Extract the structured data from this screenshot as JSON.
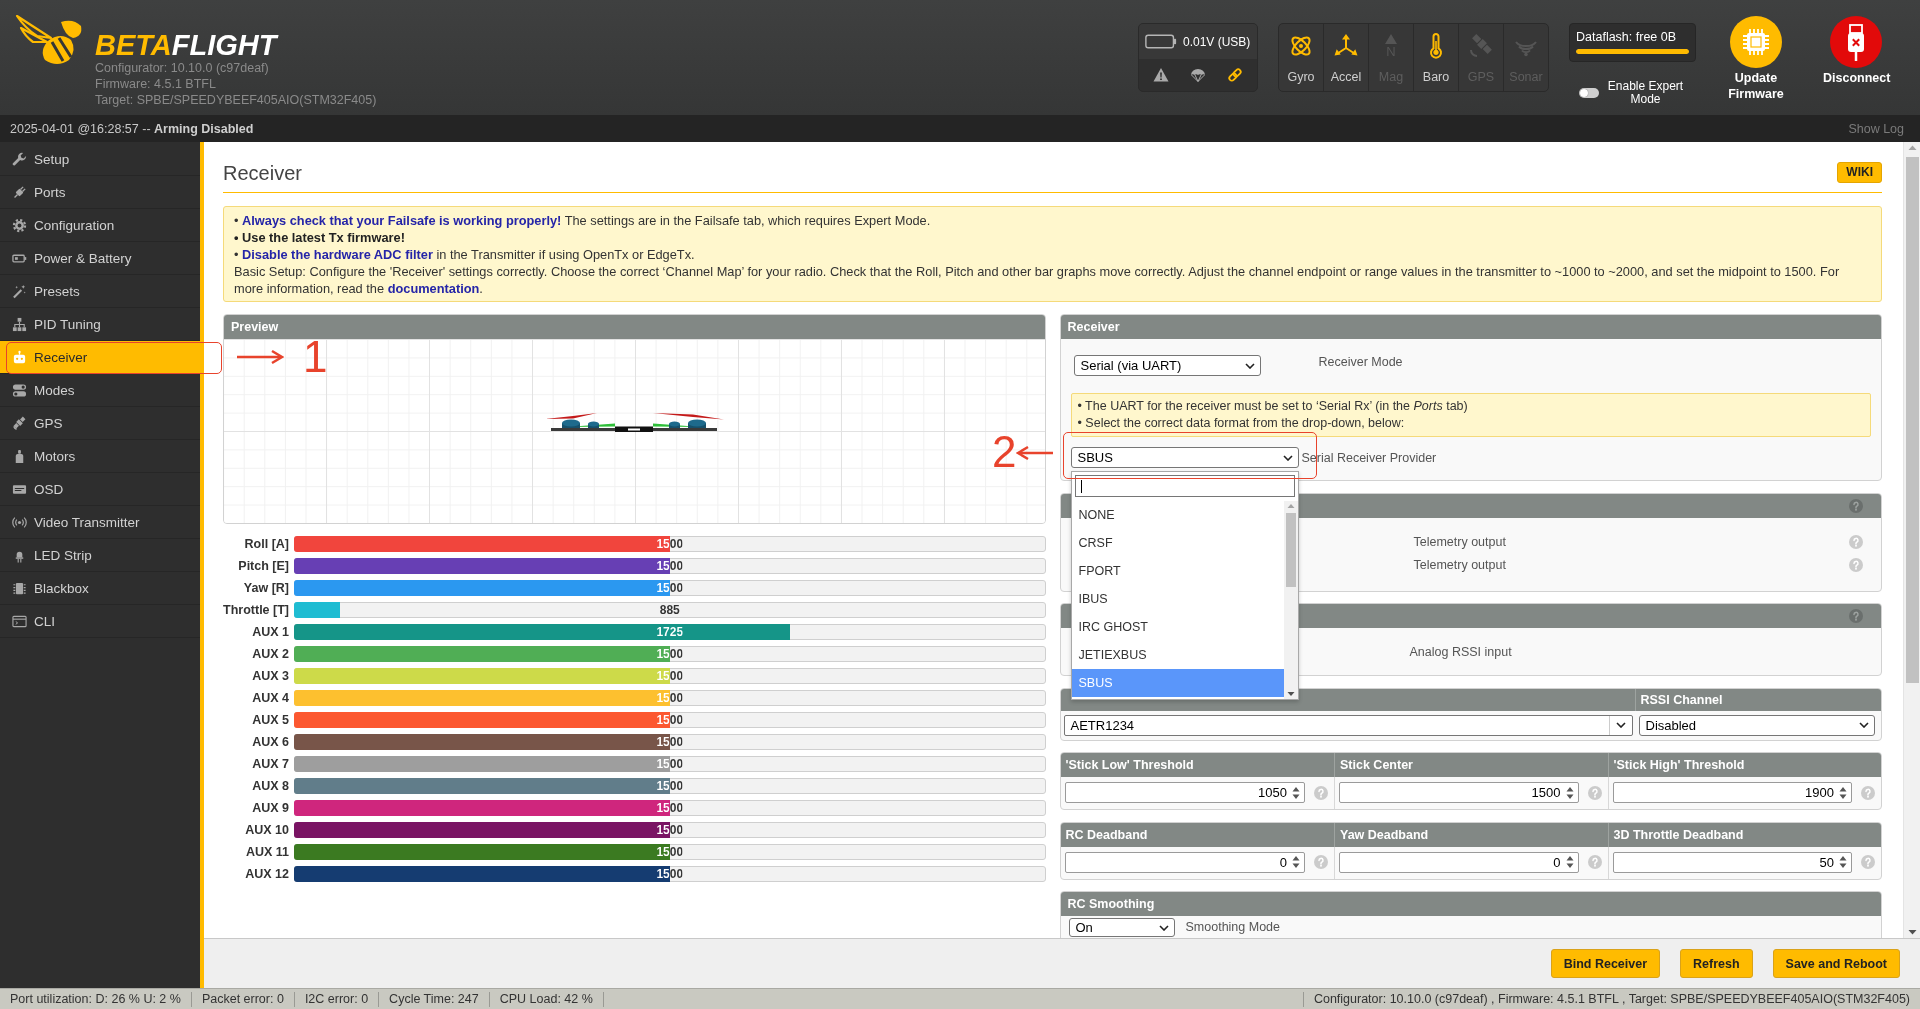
{
  "header": {
    "logo": {
      "first": "BETA",
      "second": "FLIGHT"
    },
    "version_lines": [
      "Configurator: 10.10.0 (c97deaf)",
      "Firmware: 4.5.1 BTFL",
      "Target: SPBE/SPEEDYBEEF405AIO(STM32F405)"
    ],
    "battery": {
      "reading": "0.01V (USB)",
      "indicators": [
        {
          "on": false
        },
        {
          "on": false
        },
        {
          "on": true
        }
      ]
    },
    "sensors": [
      {
        "label": "Gyro",
        "on": true
      },
      {
        "label": "Accel",
        "on": true
      },
      {
        "label": "Mag",
        "on": false,
        "symbol": "N"
      },
      {
        "label": "Baro",
        "on": true
      },
      {
        "label": "GPS",
        "on": false
      },
      {
        "label": "Sonar",
        "on": false
      }
    ],
    "dataflash": {
      "label": "Dataflash: free 0B",
      "level": 1
    },
    "expert_mode": {
      "label": "Enable Expert Mode",
      "on": false
    },
    "buttons": [
      {
        "kind": "update",
        "label": "Update Firmware"
      },
      {
        "kind": "disconnect",
        "label": "Disconnect"
      }
    ]
  },
  "status_strip": {
    "message": "2025-04-01 @16:28:57 -- **Arming Disabled**",
    "show_log": "Show Log"
  },
  "sidebar": {
    "items": [
      {
        "label": "Setup",
        "selected": false
      },
      {
        "label": "Ports",
        "selected": false
      },
      {
        "label": "Configuration",
        "selected": false
      },
      {
        "label": "Power & Battery",
        "selected": false
      },
      {
        "label": "Presets",
        "selected": false
      },
      {
        "label": "PID Tuning",
        "selected": false
      },
      {
        "label": "Receiver",
        "selected": true
      },
      {
        "label": "Modes",
        "selected": false
      },
      {
        "label": "GPS",
        "selected": false
      },
      {
        "label": "Motors",
        "selected": false
      },
      {
        "label": "OSD",
        "selected": false
      },
      {
        "label": "Video Transmitter",
        "selected": false
      },
      {
        "label": "LED Strip",
        "selected": false
      },
      {
        "label": "Blackbox",
        "selected": false
      },
      {
        "label": "CLI",
        "selected": false
      }
    ]
  },
  "page": {
    "title": "Receiver",
    "wiki_button": "WIKI",
    "notes": [
      {
        "kind": "text",
        "text": "• **Always check that your Failsafe is working properly!** The settings are in the Failsafe tab, which requires Expert Mode."
      },
      {
        "kind": "strong",
        "text": "• Use the latest Tx firmware!"
      },
      {
        "kind": "text",
        "text": "• **Disable the hardware ADC filter** in the Transmitter if using OpenTx or EdgeTx."
      },
      {
        "kind": "text",
        "text": "Basic Setup: Configure the 'Receiver' settings correctly. Choose the correct ‘Channel Map’ for your radio. Check that the Roll, Pitch and other bar graphs move correctly. Adjust the channel endpoint or range values in the transmitter to ~1000 to ~2000, and set the midpoint to 1500. For more information, read the **documentation**."
      }
    ]
  },
  "preview": {
    "title": "Preview"
  },
  "channels": [
    {
      "name": "Roll [A]",
      "reading": "1500",
      "level": 0.5,
      "color": "#f1453d"
    },
    {
      "name": "Pitch [E]",
      "reading": "1500",
      "level": 0.5,
      "color": "#673fb4"
    },
    {
      "name": "Yaw [R]",
      "reading": "1500",
      "level": 0.5,
      "color": "#2b98f0"
    },
    {
      "name": "Throttle [T]",
      "reading": "885",
      "level": 0.0607,
      "color": "#1fbcd2"
    },
    {
      "name": "AUX 1",
      "reading": "1725",
      "level": 0.6607,
      "color": "#159588"
    },
    {
      "name": "AUX 2",
      "reading": "1500",
      "level": 0.5,
      "color": "#50ae55"
    },
    {
      "name": "AUX 3",
      "reading": "1500",
      "level": 0.5,
      "color": "#cdda49"
    },
    {
      "name": "AUX 4",
      "reading": "1500",
      "level": 0.5,
      "color": "#fdc02f"
    },
    {
      "name": "AUX 5",
      "reading": "1500",
      "level": 0.5,
      "color": "#fc5830"
    },
    {
      "name": "AUX 6",
      "reading": "1500",
      "level": 0.5,
      "color": "#785549"
    },
    {
      "name": "AUX 7",
      "reading": "1500",
      "level": 0.5,
      "color": "#9e9e9e"
    },
    {
      "name": "AUX 8",
      "reading": "1500",
      "level": 0.5,
      "color": "#617d8a"
    },
    {
      "name": "AUX 9",
      "reading": "1500",
      "level": 0.5,
      "color": "#cf267d"
    },
    {
      "name": "AUX 10",
      "reading": "1500",
      "level": 0.5,
      "color": "#7a1464"
    },
    {
      "name": "AUX 11",
      "reading": "1500",
      "level": 0.5,
      "color": "#3b7a21"
    },
    {
      "name": "AUX 12",
      "reading": "1500",
      "level": 0.5,
      "color": "#153c71"
    }
  ],
  "receiver_panel": {
    "title": "Receiver",
    "mode": {
      "value": "Serial (via UART)",
      "label": "Receiver Mode"
    },
    "notes": [
      "• The UART for the receiver must be set to ‘Serial Rx’ (in the *Ports* tab)",
      "• Select the correct data format from the drop-down, below:"
    ],
    "provider": {
      "value": "SBUS",
      "label": "Serial Receiver Provider",
      "expanded": true,
      "options": [
        {
          "label": "NONE",
          "selected": false
        },
        {
          "label": "CRSF",
          "selected": false
        },
        {
          "label": "FPORT",
          "selected": false
        },
        {
          "label": "IBUS",
          "selected": false
        },
        {
          "label": "IRC GHOST",
          "selected": false
        },
        {
          "label": "JETIEXBUS",
          "selected": false
        },
        {
          "label": "SBUS",
          "selected": true
        }
      ]
    }
  },
  "telemetry_panel": {
    "rows": [
      {
        "label": "Telemetry output"
      },
      {
        "label": "Telemetry output"
      }
    ]
  },
  "rssi_panel": {
    "rows": [
      {
        "label": "Analog RSSI input"
      }
    ]
  },
  "channel_map": {
    "map_value": "AETR1234",
    "rssi_heading": "RSSI Channel",
    "rssi_value": "Disabled"
  },
  "thresholds": [
    {
      "heading": "'Stick Low' Threshold",
      "value": "1050"
    },
    {
      "heading": "Stick Center",
      "value": "1500"
    },
    {
      "heading": "'Stick High' Threshold",
      "value": "1900"
    }
  ],
  "deadbands": [
    {
      "heading": "RC Deadband",
      "value": "0"
    },
    {
      "heading": "Yaw Deadband",
      "value": "0"
    },
    {
      "heading": "3D Throttle Deadband",
      "value": "50"
    }
  ],
  "rc_smoothing": {
    "title": "RC Smoothing",
    "value": "On",
    "label": "Smoothing Mode"
  },
  "footer_buttons": [
    "Bind Receiver",
    "Refresh",
    "Save and Reboot"
  ],
  "status_bar": {
    "items": [
      "Port utilization: D: 26 % U: 2 %",
      "Packet error: 0",
      "I2C error: 0",
      "Cycle Time: 247",
      "CPU Load: 42 %"
    ],
    "right": "Configurator: 10.10.0 (c97deaf) , Firmware: 4.5.1 BTFL , Target: SPBE/SPEEDYBEEF405AIO(STM32F405)"
  },
  "annotations": [
    {
      "number": "1"
    },
    {
      "number": "2"
    }
  ]
}
